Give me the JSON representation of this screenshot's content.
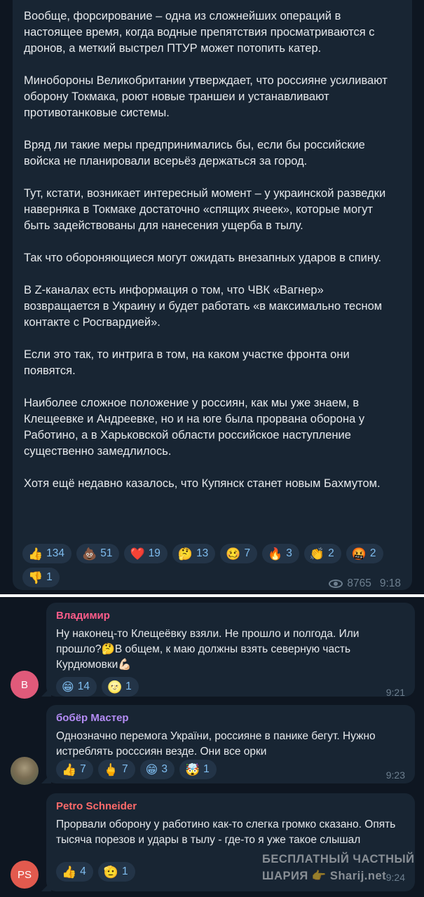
{
  "post": {
    "paragraphs": [
      "Вообще, форсирование – одна из сложнейших операций в настоящее время, когда водные препятствия просматриваются с дронов, а меткий выстрел ПТУР может потопить катер.",
      "Минобороны Великобритании утверждает, что россияне усиливают оборону Токмака, роют новые траншеи и устанавливают противотанковые системы.",
      "Вряд ли такие меры предпринимались бы, если бы российские войска не планировали всерьёз держаться за город.",
      "Тут, кстати, возникает интересный момент – у украинской разведки наверняка в Токмаке достаточно «спящих ячеек», которые могут быть задействованы для нанесения ущерба в тылу.",
      "Так что обороняющиеся могут ожидать внезапных ударов в спину.",
      "В Z-каналах есть информация о том, что ЧВК «Вагнер» возвращается в Украину и будет работать «в максимально тесном контакте с Росгвардией».",
      "Если это так, то интрига в том, на каком участке фронта они появятся.",
      "Наиболее сложное положение у россиян, как мы уже знаем, в Клещеевке и Андреевке, но и на юге была прорвана оборона у Работино, а в Харьковской области российское наступление существенно замедлилось.",
      "Хотя ещё недавно казалось, что Купянск станет новым Бахмутом."
    ],
    "reactions": [
      {
        "emoji": "👍",
        "count": "134",
        "icon": "thumbs-up-icon"
      },
      {
        "emoji": "💩",
        "count": "51",
        "icon": "poop-icon"
      },
      {
        "emoji": "❤️",
        "count": "19",
        "icon": "heart-icon"
      },
      {
        "emoji": "🤔",
        "count": "13",
        "icon": "thinking-icon"
      },
      {
        "emoji": "🥴",
        "count": "7",
        "icon": "woozy-face-icon"
      },
      {
        "emoji": "🔥",
        "count": "3",
        "icon": "fire-icon"
      },
      {
        "emoji": "👏",
        "count": "2",
        "icon": "clapping-icon"
      },
      {
        "emoji": "🤬",
        "count": "2",
        "icon": "cursing-face-icon"
      },
      {
        "emoji": "👎",
        "count": "1",
        "icon": "thumbs-down-icon"
      }
    ],
    "views": "8765",
    "time": "9:18"
  },
  "comments": [
    {
      "author": "Владимир",
      "author_color": "#ff5c8a",
      "avatar_text": "В",
      "avatar_color": "#e05a7a",
      "text": "Ну наконец-то Клещеёвку взяли. Не прошло и полгода. Или прошло?🤔В общем, к маю должны взять северную часть Курдюмовки💪🏻",
      "reactions": [
        {
          "emoji": "😁",
          "count": "14",
          "icon": "grinning-face-icon"
        },
        {
          "emoji": "🌝",
          "count": "1",
          "icon": "full-moon-face-icon"
        }
      ],
      "time": "9:21"
    },
    {
      "author": "бобёр Мастер",
      "author_color": "#b48cf5",
      "avatar_text": "",
      "avatar_color": "#6b6d52",
      "text": "Однозначно перемога України, россияне в панике бегут. Нужно истреблять росссиян везде. Они все орки",
      "reactions": [
        {
          "emoji": "👍",
          "count": "7",
          "icon": "thumbs-up-icon"
        },
        {
          "emoji": "🖕",
          "count": "7",
          "icon": "middle-finger-icon"
        },
        {
          "emoji": "😁",
          "count": "3",
          "icon": "grinning-face-icon"
        },
        {
          "emoji": "🤯",
          "count": "1",
          "icon": "exploding-head-icon"
        }
      ],
      "time": "9:23"
    },
    {
      "author": "Petro Schneider",
      "author_color": "#ff6a6a",
      "avatar_text": "PS",
      "avatar_color": "#e25a4e",
      "text": "Прорвали оборону у работино как-то слегка громко сказано. Опять тысяча порезов и удары в тылу - где-то я уже такое слышал",
      "reactions": [
        {
          "emoji": "👍",
          "count": "4",
          "icon": "thumbs-up-icon"
        },
        {
          "emoji": "🫡",
          "count": "1",
          "icon": "saluting-face-icon"
        }
      ],
      "time": "9:24"
    }
  ],
  "watermark": {
    "line1": "БЕСПЛАТНЫЙ ЧАСТНЫЙ",
    "line2": "ШАРИЯ 👉 Sharij.net"
  }
}
